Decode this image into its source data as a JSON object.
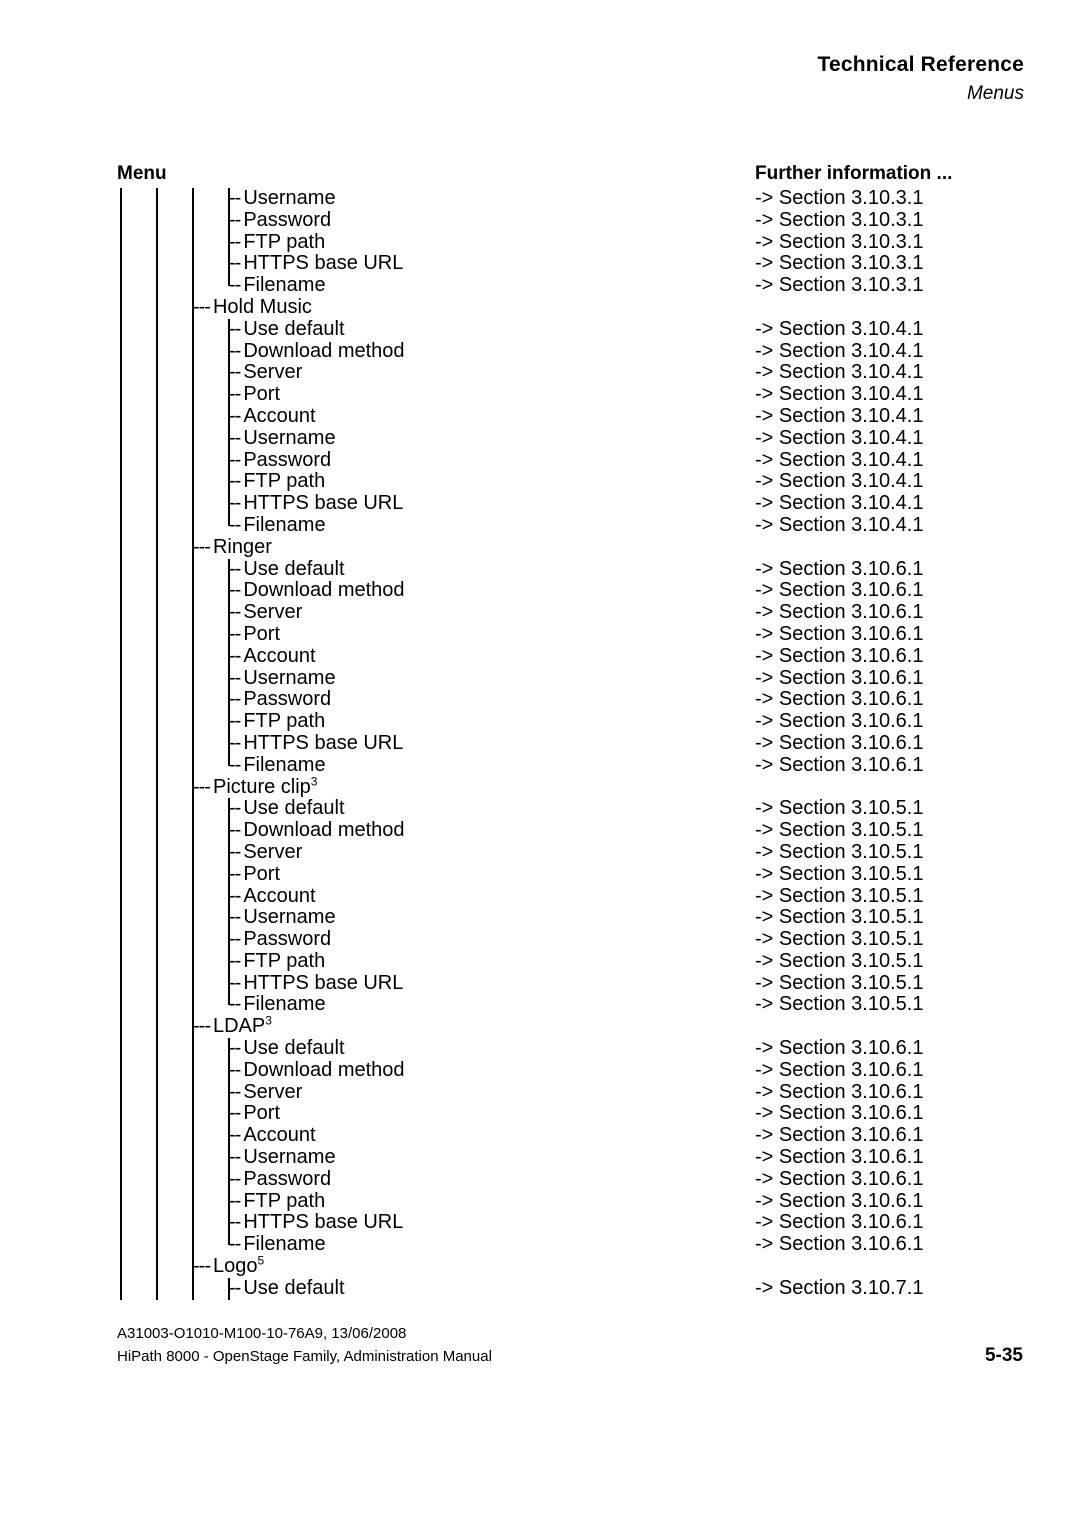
{
  "header": {
    "title": "Technical Reference",
    "subtitle": "Menus"
  },
  "columns": {
    "menu_label": "Menu",
    "further_label": "Further information ..."
  },
  "tree": {
    "rows": [
      {
        "level": 4,
        "label": "Username",
        "section": "-> Section 3.10.3.1",
        "last": false
      },
      {
        "level": 4,
        "label": "Password",
        "section": "-> Section 3.10.3.1",
        "last": false
      },
      {
        "level": 4,
        "label": "FTP path",
        "section": "-> Section 3.10.3.1",
        "last": false
      },
      {
        "level": 4,
        "label": "HTTPS base URL",
        "section": "-> Section 3.10.3.1",
        "last": false
      },
      {
        "level": 4,
        "label": "Filename",
        "section": "-> Section 3.10.3.1",
        "last": true
      },
      {
        "level": 3,
        "label": "Hold Music",
        "section": "",
        "last": false
      },
      {
        "level": 4,
        "label": "Use default",
        "section": "-> Section 3.10.4.1",
        "last": false
      },
      {
        "level": 4,
        "label": "Download method",
        "section": "-> Section 3.10.4.1",
        "last": false
      },
      {
        "level": 4,
        "label": "Server",
        "section": "-> Section 3.10.4.1",
        "last": false
      },
      {
        "level": 4,
        "label": "Port",
        "section": "-> Section 3.10.4.1",
        "last": false
      },
      {
        "level": 4,
        "label": "Account",
        "section": "-> Section 3.10.4.1",
        "last": false
      },
      {
        "level": 4,
        "label": "Username",
        "section": "-> Section 3.10.4.1",
        "last": false
      },
      {
        "level": 4,
        "label": "Password",
        "section": "-> Section 3.10.4.1",
        "last": false
      },
      {
        "level": 4,
        "label": "FTP path",
        "section": "-> Section 3.10.4.1",
        "last": false
      },
      {
        "level": 4,
        "label": "HTTPS base URL",
        "section": "-> Section 3.10.4.1",
        "last": false
      },
      {
        "level": 4,
        "label": "Filename",
        "section": "-> Section 3.10.4.1",
        "last": true
      },
      {
        "level": 3,
        "label": "Ringer",
        "section": "",
        "last": false
      },
      {
        "level": 4,
        "label": "Use default",
        "section": "-> Section 3.10.6.1",
        "last": false
      },
      {
        "level": 4,
        "label": "Download method",
        "section": "-> Section 3.10.6.1",
        "last": false
      },
      {
        "level": 4,
        "label": "Server",
        "section": "-> Section 3.10.6.1",
        "last": false
      },
      {
        "level": 4,
        "label": "Port",
        "section": "-> Section 3.10.6.1",
        "last": false
      },
      {
        "level": 4,
        "label": "Account",
        "section": "-> Section 3.10.6.1",
        "last": false
      },
      {
        "level": 4,
        "label": "Username",
        "section": "-> Section 3.10.6.1",
        "last": false
      },
      {
        "level": 4,
        "label": "Password",
        "section": "-> Section 3.10.6.1",
        "last": false
      },
      {
        "level": 4,
        "label": "FTP path",
        "section": "-> Section 3.10.6.1",
        "last": false
      },
      {
        "level": 4,
        "label": "HTTPS base URL",
        "section": "-> Section 3.10.6.1",
        "last": false
      },
      {
        "level": 4,
        "label": "Filename",
        "section": "-> Section 3.10.6.1",
        "last": true
      },
      {
        "level": 3,
        "label": "Picture clip",
        "sup": "3",
        "section": "",
        "last": false
      },
      {
        "level": 4,
        "label": "Use default",
        "section": "-> Section 3.10.5.1",
        "last": false
      },
      {
        "level": 4,
        "label": "Download method",
        "section": "-> Section 3.10.5.1",
        "last": false
      },
      {
        "level": 4,
        "label": "Server",
        "section": "-> Section 3.10.5.1",
        "last": false
      },
      {
        "level": 4,
        "label": "Port",
        "section": "-> Section 3.10.5.1",
        "last": false
      },
      {
        "level": 4,
        "label": "Account",
        "section": "-> Section 3.10.5.1",
        "last": false
      },
      {
        "level": 4,
        "label": "Username",
        "section": "-> Section 3.10.5.1",
        "last": false
      },
      {
        "level": 4,
        "label": "Password",
        "section": "-> Section 3.10.5.1",
        "last": false
      },
      {
        "level": 4,
        "label": "FTP path",
        "section": "-> Section 3.10.5.1",
        "last": false
      },
      {
        "level": 4,
        "label": "HTTPS base URL",
        "section": "-> Section 3.10.5.1",
        "last": false
      },
      {
        "level": 4,
        "label": "Filename",
        "section": "-> Section 3.10.5.1",
        "last": true
      },
      {
        "level": 3,
        "label": "LDAP",
        "sup": "3",
        "section": "",
        "last": false
      },
      {
        "level": 4,
        "label": "Use default",
        "section": "-> Section 3.10.6.1",
        "last": false
      },
      {
        "level": 4,
        "label": "Download method",
        "section": "-> Section 3.10.6.1",
        "last": false
      },
      {
        "level": 4,
        "label": "Server",
        "section": "-> Section 3.10.6.1",
        "last": false
      },
      {
        "level": 4,
        "label": "Port",
        "section": "-> Section 3.10.6.1",
        "last": false
      },
      {
        "level": 4,
        "label": "Account",
        "section": "-> Section 3.10.6.1",
        "last": false
      },
      {
        "level": 4,
        "label": "Username",
        "section": "-> Section 3.10.6.1",
        "last": false
      },
      {
        "level": 4,
        "label": "Password",
        "section": "-> Section 3.10.6.1",
        "last": false
      },
      {
        "level": 4,
        "label": "FTP path",
        "section": "-> Section 3.10.6.1",
        "last": false
      },
      {
        "level": 4,
        "label": "HTTPS base URL",
        "section": "-> Section 3.10.6.1",
        "last": false
      },
      {
        "level": 4,
        "label": "Filename",
        "section": "-> Section 3.10.6.1",
        "last": true
      },
      {
        "level": 3,
        "label": "Logo",
        "sup": "5",
        "section": "",
        "last": false
      },
      {
        "level": 4,
        "label": "Use default",
        "section": "-> Section 3.10.7.1",
        "last": false
      }
    ],
    "dash_level3": "---",
    "dash_level4": "--"
  },
  "footer": {
    "doc_id": "A31003-O1010-M100-10-76A9, 13/06/2008",
    "manual": "HiPath 8000 - OpenStage Family, Administration Manual",
    "page_number": "5-35"
  }
}
